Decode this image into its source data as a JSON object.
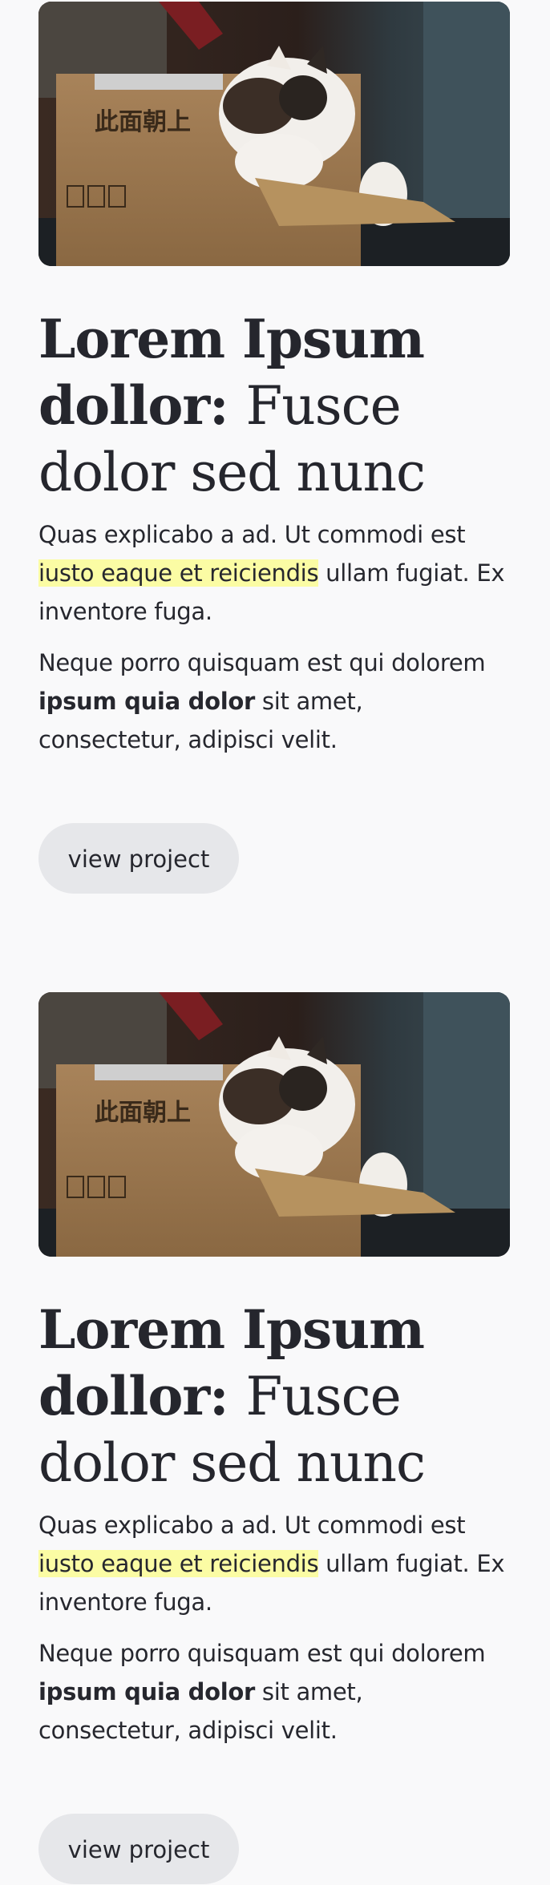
{
  "projects": [
    {
      "image": {
        "subject": "cat-in-cardboard-box-photo",
        "box_text": "此面朝上"
      },
      "title_bold": "Lorem Ipsum dollor:",
      "title_rest": "Fusce dolor sed nunc",
      "para1_before": "Quas explicabo a ad. Ut commodi est ",
      "para1_highlight": "iusto eaque et reiciendis",
      "para1_after": " ullam fugiat. Ex inventore fuga.",
      "para2_before": "Neque porro quisquam est qui dolorem ",
      "para2_bold": "ipsum quia dolor",
      "para2_after": " sit amet, consectetur, adipisci velit.",
      "button_label": "view project"
    },
    {
      "image": {
        "subject": "cat-in-cardboard-box-photo",
        "box_text": "此面朝上"
      },
      "title_bold": "Lorem Ipsum dollor:",
      "title_rest": "Fusce dolor sed nunc",
      "para1_before": "Quas explicabo a ad. Ut commodi est ",
      "para1_highlight": "iusto eaque et reiciendis",
      "para1_after": " ullam fugiat. Ex inventore fuga.",
      "para2_before": "Neque porro quisquam est qui dolorem ",
      "para2_bold": "ipsum quia dolor",
      "para2_after": " sit amet, consectetur, adipisci velit.",
      "button_label": "view project"
    }
  ],
  "colors": {
    "background": "#f9f9fa",
    "text": "#25262d",
    "highlight": "#fbfca4",
    "button_bg": "#e6e7ea"
  }
}
